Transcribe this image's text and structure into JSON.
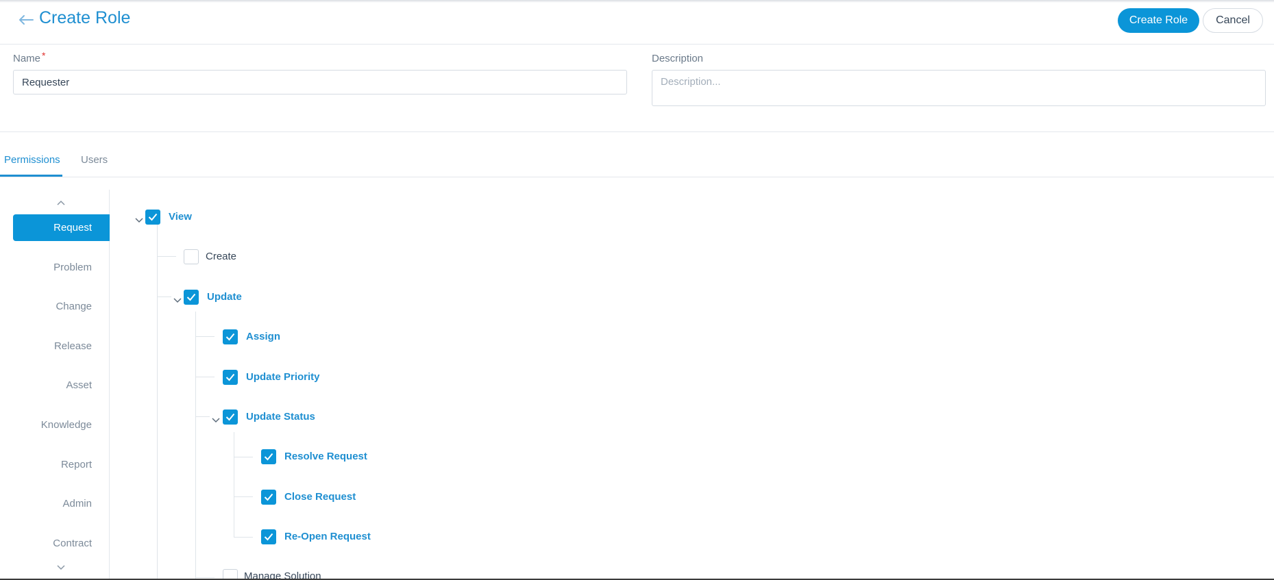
{
  "header": {
    "title": "Create Role",
    "create_button": "Create Role",
    "cancel_button": "Cancel"
  },
  "form": {
    "name_label": "Name",
    "name_required_marker": "*",
    "name_value": "Requester",
    "description_label": "Description",
    "description_placeholder": "Description..."
  },
  "tabs": [
    {
      "label": "Permissions",
      "active": true
    },
    {
      "label": "Users",
      "active": false
    }
  ],
  "sidebar": {
    "items": [
      {
        "label": "Request",
        "active": true
      },
      {
        "label": "Problem"
      },
      {
        "label": "Change"
      },
      {
        "label": "Release"
      },
      {
        "label": "Asset"
      },
      {
        "label": "Knowledge"
      },
      {
        "label": "Report"
      },
      {
        "label": "Admin"
      },
      {
        "label": "Contract"
      }
    ]
  },
  "permissions": {
    "view": {
      "label": "View",
      "checked": true,
      "expanded": true
    },
    "create": {
      "label": "Create",
      "checked": false
    },
    "update": {
      "label": "Update",
      "checked": true,
      "expanded": true
    },
    "assign": {
      "label": "Assign",
      "checked": true
    },
    "update_priority": {
      "label": "Update Priority",
      "checked": true
    },
    "update_status": {
      "label": "Update Status",
      "checked": true,
      "expanded": true
    },
    "resolve_request": {
      "label": "Resolve Request",
      "checked": true
    },
    "close_request": {
      "label": "Close Request",
      "checked": true
    },
    "reopen_request": {
      "label": "Re-Open Request",
      "checked": true
    },
    "manage_solution": {
      "label": "Manage Solution",
      "checked": false
    }
  },
  "colors": {
    "accent": "#0b95d8",
    "accent_text": "#1f8fd1",
    "required": "#e0312e"
  },
  "icons": [
    "back-arrow-icon",
    "chevron-up-icon",
    "chevron-down-icon",
    "check-icon",
    "caret-down-icon"
  ]
}
